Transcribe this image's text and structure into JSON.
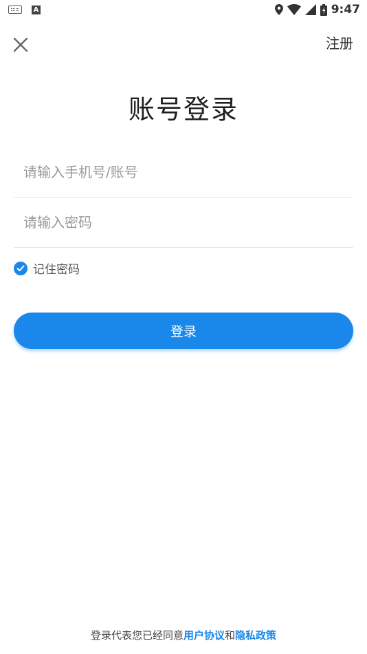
{
  "status_bar": {
    "time": "9:47",
    "icons": [
      "keyboard-icon",
      "a-icon",
      "location-icon",
      "wifi-icon",
      "signal-icon",
      "battery-icon"
    ]
  },
  "header": {
    "close_icon": "close-icon",
    "register_label": "注册"
  },
  "title": "账号登录",
  "form": {
    "account_placeholder": "请输入手机号/账号",
    "account_value": "",
    "password_placeholder": "请输入密码",
    "password_value": "",
    "remember_label": "记住密码",
    "remember_checked": true,
    "login_label": "登录"
  },
  "footer": {
    "prefix": "登录代表您已经同意",
    "user_agreement": "用户协议",
    "conjunction": "和",
    "privacy_policy": "隐私政策"
  },
  "colors": {
    "accent": "#1a87ea",
    "text": "#333333",
    "placeholder": "#9a9a9a"
  }
}
